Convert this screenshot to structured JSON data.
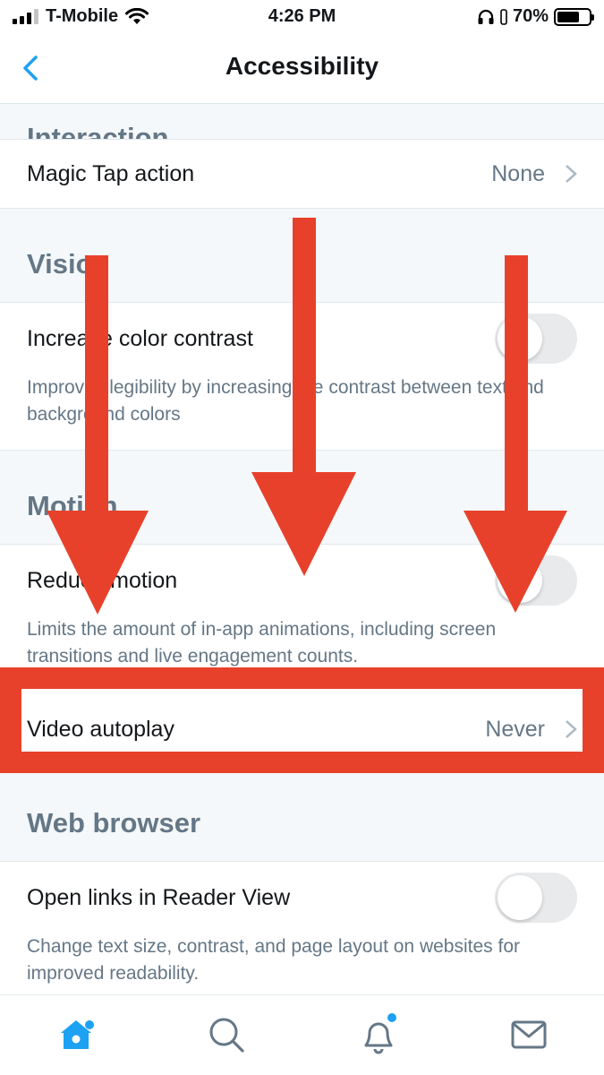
{
  "status_bar": {
    "carrier": "T-Mobile",
    "time": "4:26 PM",
    "battery": "70%",
    "battery_level": 0.7,
    "icons": [
      "signal-icon",
      "wifi-icon",
      "headphones-icon",
      "battery-icon"
    ]
  },
  "nav": {
    "title": "Accessibility",
    "back_icon": "chevron-left-icon"
  },
  "sections": {
    "interaction": {
      "header": "Interaction",
      "magic_tap": {
        "label": "Magic Tap action",
        "value": "None"
      }
    },
    "vision": {
      "header": "Vision",
      "contrast": {
        "label": "Increase color contrast",
        "description": "Improves legibility by increasing the contrast between text and background colors",
        "enabled": false
      }
    },
    "motion": {
      "header": "Motion",
      "reduce_motion": {
        "label": "Reduce motion",
        "description": "Limits the amount of in-app animations, including screen transitions and live engagement counts.",
        "enabled": false
      },
      "video_autoplay": {
        "label": "Video autoplay",
        "value": "Never"
      }
    },
    "web_browser": {
      "header": "Web browser",
      "reader_view": {
        "label": "Open links in Reader View",
        "description": "Change text size, contrast, and page layout on websites for improved readability.",
        "enabled": false
      }
    }
  },
  "tab_bar": {
    "tabs": [
      "home-icon",
      "search-icon",
      "notifications-icon",
      "messages-icon"
    ],
    "active": "home-icon"
  },
  "colors": {
    "accent": "#1da1f2",
    "annotation_red": "#e8412b",
    "secondary_text": "#657786"
  }
}
